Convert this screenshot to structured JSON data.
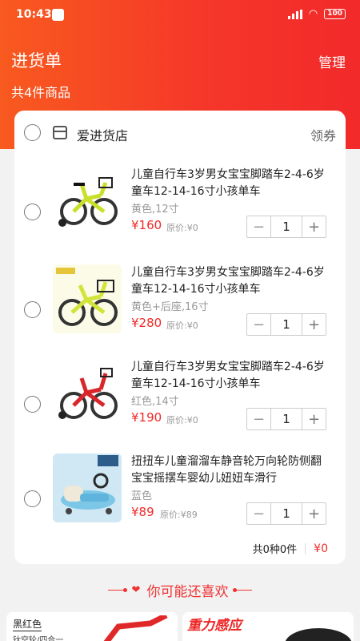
{
  "status_bar": {
    "time": "10:43",
    "battery": "100"
  },
  "header": {
    "title": "进货单",
    "manage_label": "管理",
    "count_text": "共4件商品"
  },
  "store": {
    "name": "爱进货店",
    "coupon_label": "领券"
  },
  "items": [
    {
      "title": "儿童自行车3岁男女宝宝脚踏车2-4-6岁童车12-14-16寸小孩单车",
      "spec": "黄色,12寸",
      "price": "¥160",
      "orig": "原价:¥0",
      "qty": "1",
      "color": "#c9e02a"
    },
    {
      "title": "儿童自行车3岁男女宝宝脚踏车2-4-6岁童车12-14-16寸小孩单车",
      "spec": "黄色+后座,16寸",
      "price": "¥280",
      "orig": "原价:¥0",
      "qty": "1",
      "color": "#d2e43a"
    },
    {
      "title": "儿童自行车3岁男女宝宝脚踏车2-4-6岁童车12-14-16寸小孩单车",
      "spec": "红色,14寸",
      "price": "¥190",
      "orig": "原价:¥0",
      "qty": "1",
      "color": "#d8262a"
    },
    {
      "title": "扭扭车儿童溜溜车静音轮万向轮防侧翻宝宝摇摆车婴幼儿妞妞车滑行",
      "spec": "蓝色",
      "price": "¥89",
      "orig": "原价:¥89",
      "qty": "1",
      "color": "#8fd3ef"
    }
  ],
  "summary": {
    "count_text": "共0种0件",
    "total": "¥0"
  },
  "recommend": {
    "title": "你可能还喜欢"
  },
  "rec_cards": {
    "left_tag1": "黑红色",
    "left_tag2": "钛空轮/四合一",
    "right_brand": "重力感应"
  },
  "colors": {
    "brand_red": "#f22a2a",
    "price_red": "#f02a2a",
    "gradient_start": "#f85a1f"
  }
}
